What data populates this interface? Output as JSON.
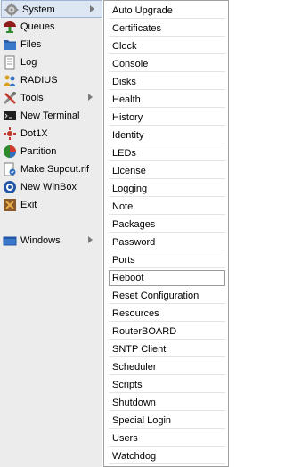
{
  "main_menu": {
    "items": [
      {
        "label": "System",
        "icon": "gear-icon",
        "has_submenu": true,
        "selected": true
      },
      {
        "label": "Queues",
        "icon": "queues-icon"
      },
      {
        "label": "Files",
        "icon": "folder-icon"
      },
      {
        "label": "Log",
        "icon": "log-icon"
      },
      {
        "label": "RADIUS",
        "icon": "radius-users-icon"
      },
      {
        "label": "Tools",
        "icon": "tools-icon",
        "has_submenu": true
      },
      {
        "label": "New Terminal",
        "icon": "terminal-icon"
      },
      {
        "label": "Dot1X",
        "icon": "dot1x-icon"
      },
      {
        "label": "Partition",
        "icon": "partition-pie-icon"
      },
      {
        "label": "Make Supout.rif",
        "icon": "supout-icon"
      },
      {
        "label": "New WinBox",
        "icon": "winbox-icon"
      },
      {
        "label": "Exit",
        "icon": "exit-icon"
      },
      {
        "label": "Windows",
        "icon": "windows-icon",
        "has_submenu": true
      }
    ]
  },
  "system_submenu": {
    "hovered_item": "Reboot",
    "items": [
      "Auto Upgrade",
      "Certificates",
      "Clock",
      "Console",
      "Disks",
      "Health",
      "History",
      "Identity",
      "LEDs",
      "License",
      "Logging",
      "Note",
      "Packages",
      "Password",
      "Ports",
      "Reboot",
      "Reset Configuration",
      "Resources",
      "RouterBOARD",
      "SNTP Client",
      "Scheduler",
      "Scripts",
      "Shutdown",
      "Special Login",
      "Users",
      "Watchdog"
    ]
  },
  "colors": {
    "menu_bg": "#ececec",
    "selected_bg": "#dde6f3",
    "selected_border": "#9fb5d3",
    "submenu_bg": "#ffffff"
  }
}
